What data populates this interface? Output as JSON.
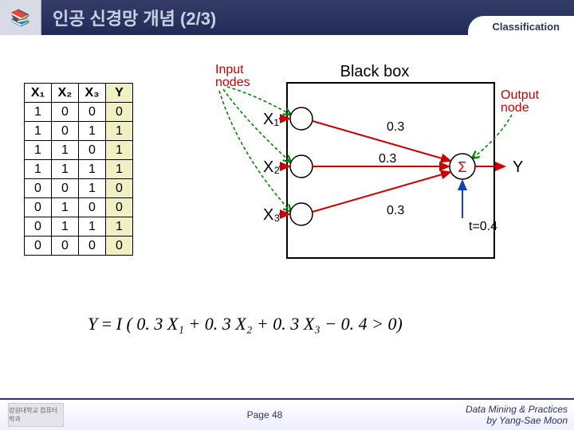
{
  "header": {
    "title": "인공 신경망 개념 (2/3)",
    "tag": "Classification",
    "icon": "📚"
  },
  "truth_table": {
    "headers": [
      "X₁",
      "X₂",
      "X₃",
      "Y"
    ],
    "rows": [
      [
        "1",
        "0",
        "0",
        "0"
      ],
      [
        "1",
        "0",
        "1",
        "1"
      ],
      [
        "1",
        "1",
        "0",
        "1"
      ],
      [
        "1",
        "1",
        "1",
        "1"
      ],
      [
        "0",
        "0",
        "1",
        "0"
      ],
      [
        "0",
        "1",
        "0",
        "0"
      ],
      [
        "0",
        "1",
        "1",
        "1"
      ],
      [
        "0",
        "0",
        "0",
        "0"
      ]
    ]
  },
  "diagram": {
    "input_label": "Input\nnodes",
    "output_label": "Output\nnode",
    "blackbox_label": "Black box",
    "inputs": [
      "X₁",
      "X₂",
      "X₃"
    ],
    "weights": [
      "0.3",
      "0.3",
      "0.3"
    ],
    "sigma": "Σ",
    "output": "Y",
    "threshold": "t=0.4"
  },
  "equation": {
    "lhs": "Y",
    "rhs_prefix": "I ( ",
    "terms": "0. 3 X₁ + 0. 3 X₂ + 0. 3 X₃ − 0. 4 > 0",
    "rhs_suffix": ")"
  },
  "footer": {
    "page": "Page 48",
    "credit_line1": "Data Mining & Practices",
    "credit_line2": "by Yang-Sae Moon",
    "logo_text": "강원대학교\n컴퓨터학과"
  }
}
